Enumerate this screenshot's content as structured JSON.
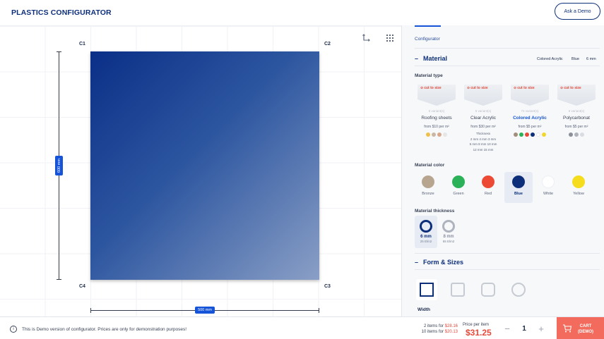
{
  "header": {
    "title": "PLASTICS CONFIGURATOR",
    "demo_button": "Ask a Demo"
  },
  "canvas": {
    "corners": {
      "c1": "C1",
      "c2": "C2",
      "c3": "C3",
      "c4": "C4"
    },
    "height_label": "600 mm",
    "width_label": "500 mm",
    "shape_color_start": "#0a2f87",
    "shape_color_end": "#8a9fc6",
    "tools": [
      "rotate-icon",
      "grid-icon"
    ]
  },
  "panel": {
    "breadcrumb": "Configurator",
    "material": {
      "title": "Material",
      "summary": {
        "type": "Colored Acrylic",
        "color": "Blue",
        "thickness": "6 mm"
      },
      "type_label": "Material type",
      "cards": [
        {
          "badge": "cut to size",
          "variants": "6 variant(s)",
          "name": "Roofing sheets",
          "price": "from $10 per m²",
          "colors": [
            "#f0c04a",
            "#c9b7a3",
            "#d9a88a",
            "#e6e6e6"
          ]
        },
        {
          "badge": "cut to size",
          "variants": "6 variant(s)",
          "name": "Clear Acrylic",
          "price": "from $30 per m²",
          "thickness_title": "Thickness",
          "thickness_rows": [
            "2 mm 4 mm 3 mm",
            "5 mm 8 mm 10 mm",
            "12 mm 15 mm"
          ]
        },
        {
          "badge": "cut to size",
          "variants": "72 variant(s)",
          "name": "Colored Acrylic",
          "price": "from $5 per m²",
          "selected": true,
          "colors": [
            "#a08f7a",
            "#2bb158",
            "#e84a3a",
            "#0d2f7a",
            "#ffffff",
            "#f2d62b"
          ]
        },
        {
          "badge": "cut to size",
          "variants": "6 variant(s)",
          "name": "Polycarbonat",
          "price": "from $5 per m²",
          "colors": [
            "#8a8f99",
            "#aeb3bd",
            "#d9dce1"
          ]
        }
      ],
      "color_label": "Material color",
      "colors": [
        {
          "name": "Bronze",
          "hex": "#b8a58f"
        },
        {
          "name": "Green",
          "hex": "#2bb158"
        },
        {
          "name": "Red",
          "hex": "#ec4a35"
        },
        {
          "name": "Blue",
          "hex": "#0d2f7a",
          "selected": true
        },
        {
          "name": "White",
          "hex": "#ffffff"
        },
        {
          "name": "Yellow",
          "hex": "#f5dc1c"
        }
      ],
      "thickness_label": "Material thickness",
      "thicknesses": [
        {
          "mm": "6 mm",
          "weight": "25 Elm2",
          "selected": true
        },
        {
          "mm": "8 mm",
          "weight": "65 Elm2"
        }
      ]
    },
    "form": {
      "title": "Form & Sizes",
      "shapes": [
        "square-icon",
        "rounded-square-icon",
        "rounded-rect-icon",
        "circle-icon"
      ],
      "width_label": "Width"
    }
  },
  "footer": {
    "notice": "This is Demo version of configurator. Prices are only for demonstration purposes!",
    "tier1_prefix": "2 items for ",
    "tier1_price": "$28.16",
    "tier2_prefix": "10 items for ",
    "tier2_price": "$20.13",
    "price_label": "Price per item",
    "price": "$31.25",
    "minus": "−",
    "plus": "+",
    "quantity": "1",
    "cart_line1": "CART",
    "cart_line2": "(DEMO)"
  }
}
